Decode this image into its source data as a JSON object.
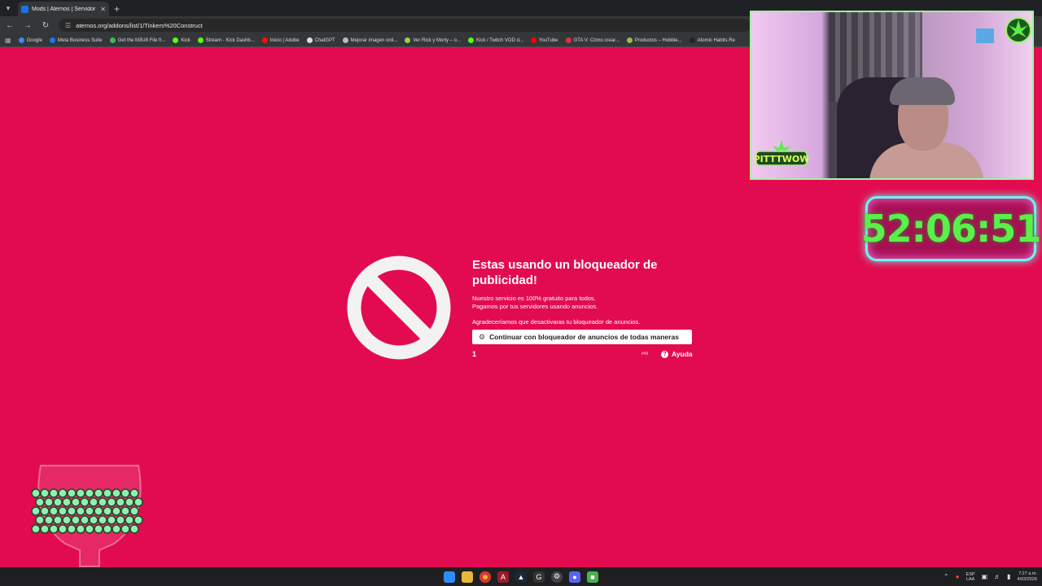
{
  "browser": {
    "tab_title": "Mods | Aternos | Servidor de M",
    "url": "aternos.org/addons/list/1/Tinkers%20Construct",
    "bookmarks": [
      {
        "label": "Google",
        "color": "#4285f4"
      },
      {
        "label": "Meta Business Suite",
        "color": "#1877f2"
      },
      {
        "label": "Get the M3U8 File fr...",
        "color": "#3cba54"
      },
      {
        "label": "Kick",
        "color": "#53fc18"
      },
      {
        "label": "Stream - Kick Dashb...",
        "color": "#53fc18"
      },
      {
        "label": "Inicio | Adobe",
        "color": "#fa0f00"
      },
      {
        "label": "ChatGPT",
        "color": "#dddddd"
      },
      {
        "label": "Mejorar imagen onli...",
        "color": "#bbbbbb"
      },
      {
        "label": "Ver Rick y Morty – o...",
        "color": "#97ce4c"
      },
      {
        "label": "Kick / Twitch VOD d...",
        "color": "#53fc18"
      },
      {
        "label": "YouTube",
        "color": "#ff0000"
      },
      {
        "label": "GTA V: Cómo crear...",
        "color": "#e0313d"
      },
      {
        "label": "Productos – Hobbie...",
        "color": "#95bf47"
      },
      {
        "label": "Atomic Habits Re",
        "color": "#222222"
      }
    ]
  },
  "notice": {
    "title": "Estas usando un bloqueador de publicidad!",
    "line1": "Nuestro servicio es 100% gratuito para todos.",
    "line2": "Pagamos por tus servidores usando anuncios.",
    "line3": "Agradeceríamos que desactivaras tu bloqueador de anuncios.",
    "continue_label": "Continuar con bloqueador de anuncios de todas maneras",
    "counter": "1",
    "code": "#49",
    "help_label": "Ayuda"
  },
  "overlay": {
    "timer": "52:06:51",
    "logo_text": "PITTTWOW"
  },
  "colors": {
    "page_bg": "#e30b4f",
    "timer_text": "#59f04a",
    "timer_border": "#6bf6f0"
  },
  "taskbar": {
    "lang_top": "ESP",
    "lang_bottom": "LAA",
    "time": "7:27 a.m.",
    "date": "4/03/2026"
  }
}
